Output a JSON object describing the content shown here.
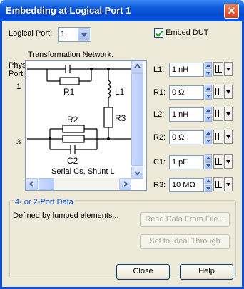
{
  "window": {
    "title": "Embedding at Logical Port 1",
    "close_symbol": "✕"
  },
  "logical_port": {
    "label": "Logical Port:",
    "value": "1"
  },
  "embed_dut": {
    "label": "Embed DUT",
    "checked": true
  },
  "network": {
    "heading": "Transformation Network:",
    "phys_port_label_line1": "Phys",
    "phys_port_label_line2": "Port:",
    "port_top": "1",
    "port_bottom": "3",
    "components": {
      "r1": "R1",
      "l1": "L1",
      "r3": "R3",
      "r2": "R2",
      "c2": "C2"
    },
    "caption": "Serial Cs, Shunt L"
  },
  "params": [
    {
      "label": "L1:",
      "value": "1 nH"
    },
    {
      "label": "R1:",
      "value": "0 Ω"
    },
    {
      "label": "L2:",
      "value": "1 nH"
    },
    {
      "label": "R2:",
      "value": "0 Ω"
    },
    {
      "label": "C1:",
      "value": "1 pF"
    },
    {
      "label": "R3:",
      "value": "10 MΩ"
    }
  ],
  "port_data": {
    "title": "4- or 2-Port Data",
    "description": "Defined by lumped elements...",
    "read_button": "Read Data From File...",
    "ideal_button": "Set to Ideal Through"
  },
  "footer": {
    "close_label": "Close",
    "help_label": "Help"
  }
}
